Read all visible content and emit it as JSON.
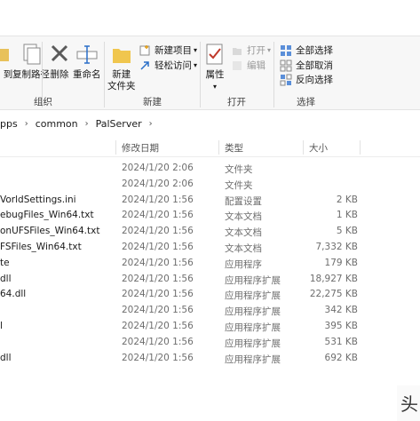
{
  "ribbon": {
    "clipboard": {
      "cut_label": "到",
      "copy_path_label": "复制路径",
      "group_label": "组织"
    },
    "organize": {
      "delete_label": "删除",
      "rename_label": "重命名"
    },
    "new": {
      "new_item_label": "新建项目",
      "easy_access_label": "轻松访问",
      "new_folder_label_1": "新建",
      "new_folder_label_2": "文件夹",
      "group_label": "新建"
    },
    "open": {
      "properties_label": "属性",
      "open_label": "打开",
      "edit_label": "编辑",
      "group_label": "打开"
    },
    "select": {
      "select_all_label": "全部选择",
      "select_none_label": "全部取消",
      "invert_label": "反向选择",
      "group_label": "选择"
    }
  },
  "address": {
    "crumbs": [
      "pps",
      "common",
      "PalServer"
    ]
  },
  "columns": {
    "date": "修改日期",
    "type": "类型",
    "size": "大小"
  },
  "files": [
    {
      "name": "",
      "date": "2024/1/20 2:06",
      "type": "文件夹",
      "size": ""
    },
    {
      "name": "",
      "date": "2024/1/20 2:06",
      "type": "文件夹",
      "size": ""
    },
    {
      "name": "VorldSettings.ini",
      "date": "2024/1/20 1:56",
      "type": "配置设置",
      "size": "2 KB"
    },
    {
      "name": "ebugFiles_Win64.txt",
      "date": "2024/1/20 1:56",
      "type": "文本文档",
      "size": "1 KB"
    },
    {
      "name": "onUFSFiles_Win64.txt",
      "date": "2024/1/20 1:56",
      "type": "文本文档",
      "size": "5 KB"
    },
    {
      "name": "FSFiles_Win64.txt",
      "date": "2024/1/20 1:56",
      "type": "文本文档",
      "size": "7,332 KB"
    },
    {
      "name": "te",
      "date": "2024/1/20 1:56",
      "type": "应用程序",
      "size": "179 KB"
    },
    {
      "name": "dll",
      "date": "2024/1/20 1:56",
      "type": "应用程序扩展",
      "size": "18,927 KB"
    },
    {
      "name": "64.dll",
      "date": "2024/1/20 1:56",
      "type": "应用程序扩展",
      "size": "22,275 KB"
    },
    {
      "name": "",
      "date": "2024/1/20 1:56",
      "type": "应用程序扩展",
      "size": "342 KB"
    },
    {
      "name": "l",
      "date": "2024/1/20 1:56",
      "type": "应用程序扩展",
      "size": "395 KB"
    },
    {
      "name": "",
      "date": "2024/1/20 1:56",
      "type": "应用程序扩展",
      "size": "531 KB"
    },
    {
      "name": "dll",
      "date": "2024/1/20 1:56",
      "type": "应用程序扩展",
      "size": "692 KB"
    }
  ],
  "watermark": "头"
}
